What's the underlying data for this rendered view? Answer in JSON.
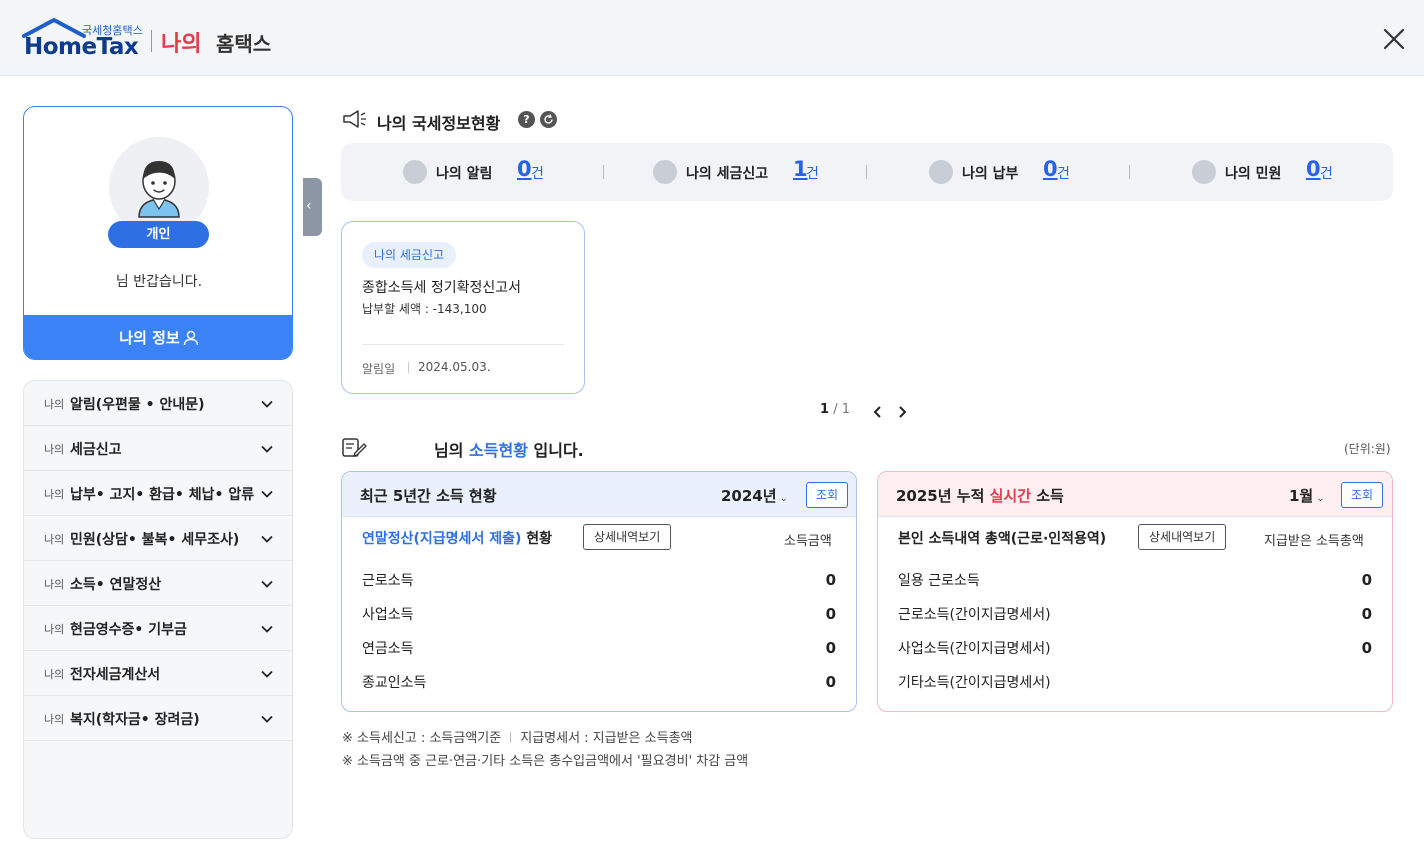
{
  "header": {
    "logo_small": "국세청홈택스",
    "logo_main": "HomeTax",
    "title_mine": "나의",
    "title_rest": "홈택스"
  },
  "profile": {
    "badge": "개인",
    "greeting": "님 반갑습니다.",
    "my_info": "나의 정보"
  },
  "menu": {
    "prefix": "나의",
    "items": [
      "알림(우편물 • 안내문)",
      "세금신고",
      "납부• 고지• 환급• 체납• 압류",
      "민원(상담• 불복• 세무조사)",
      "소득• 연말정산",
      "현금영수증• 기부금",
      "전자세금계산서",
      "복지(학자금• 장려금)"
    ]
  },
  "status": {
    "title": "나의 국세정보현황",
    "help": "?",
    "items": [
      {
        "label": "나의 알림",
        "count": "0",
        "unit": "건",
        "icon": "megaphone-icon"
      },
      {
        "label": "나의 세금신고",
        "count": "1",
        "unit": "건",
        "icon": "document-edit-icon"
      },
      {
        "label": "나의 납부",
        "count": "0",
        "unit": "건",
        "icon": "payment-icon"
      },
      {
        "label": "나의 민원",
        "count": "0",
        "unit": "건",
        "icon": "clipboard-icon"
      }
    ]
  },
  "notice": {
    "tag": "나의 세금신고",
    "title": "종합소득세 정기확정신고서",
    "tax": "납부할 세액 : -143,100",
    "date_label": "알림일",
    "date": "2024.05.03."
  },
  "pager": {
    "current": "1",
    "separator": "/",
    "total": "1"
  },
  "income": {
    "title_pre": "님의",
    "title_highlight": "소득현황",
    "title_post": "입니다.",
    "unit": "(단위:원)",
    "left": {
      "title": "최근 5년간 소득 현황",
      "year": "2024년",
      "query": "조회",
      "sub_highlight": "연말정산(지급명세서 제출)",
      "sub_rest": "현황",
      "detail": "상세내역보기",
      "col": "소득금액",
      "rows": [
        {
          "label": "근로소득",
          "value": "0"
        },
        {
          "label": "사업소득",
          "value": "0"
        },
        {
          "label": "연금소득",
          "value": "0"
        },
        {
          "label": "종교인소득",
          "value": "0"
        }
      ]
    },
    "right": {
      "title_pre": "2025년 누적",
      "title_red": "실시간",
      "title_post": "소득",
      "month": "1월",
      "query": "조회",
      "sub": "본인 소득내역 총액(근로·인적용역)",
      "detail": "상세내역보기",
      "col": "지급받은 소득총액",
      "rows": [
        {
          "label": "일용 근로소득",
          "value": "0"
        },
        {
          "label": "근로소득(간이지급명세서)",
          "value": "0"
        },
        {
          "label": "사업소득(간이지급명세서)",
          "value": "0"
        },
        {
          "label": "기타소득(간이지급명세서)",
          "value": ""
        }
      ]
    }
  },
  "footnotes": {
    "line1_a": "※ 소득세신고 : 소득금액기준",
    "line1_b": "지급명세서 : 지급받은 소득총액",
    "line2": "※ 소득금액 중 근로·연금·기타 소득은 총수입금액에서 '필요경비' 차감 금액"
  }
}
